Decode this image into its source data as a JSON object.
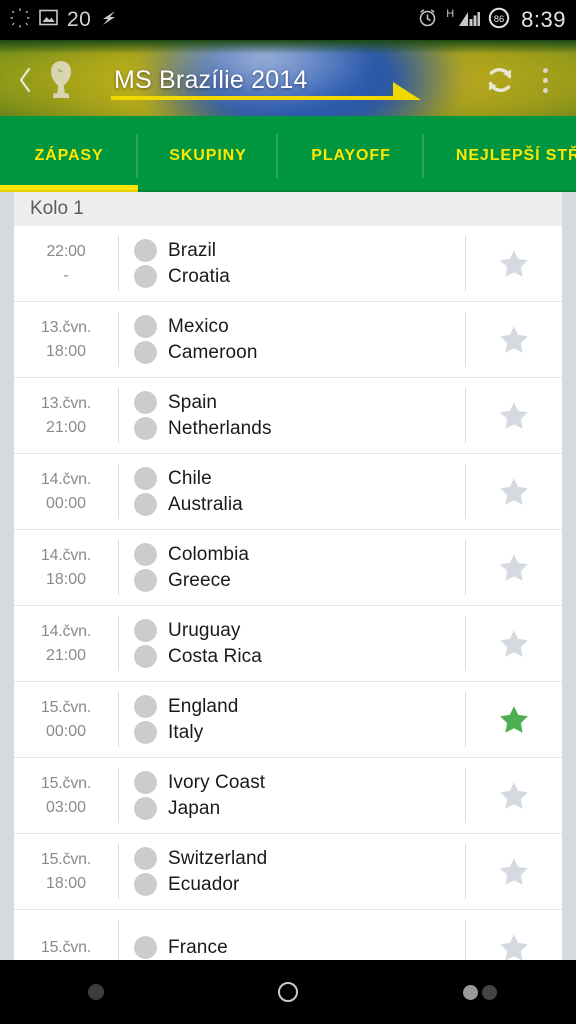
{
  "statusbar": {
    "brightness_icon": "brightness-icon",
    "screenshot_icon": "image-icon",
    "notif_count": "20",
    "charging_icon": "lightning-bolt-icon",
    "alarm_icon": "alarm-clock-icon",
    "network_type": "H",
    "signal_icon": "signal-bars-icon",
    "battery_level": "86",
    "clock": "8:39"
  },
  "header": {
    "back_icon": "back-chevron-icon",
    "logo_icon": "trophy-icon",
    "title": "MS Brazílie 2014",
    "refresh_icon": "refresh-icon",
    "overflow_icon": "overflow-menu-icon"
  },
  "tabs": {
    "active_index": 0,
    "items": [
      {
        "label": "ZÁPASY"
      },
      {
        "label": "SKUPINY"
      },
      {
        "label": "PLAYOFF"
      },
      {
        "label": "NEJLEPŠÍ STŘE"
      }
    ]
  },
  "list": {
    "group_header": "Kolo 1",
    "matches": [
      {
        "date": "",
        "time": "22:00",
        "home": "Brazil",
        "away": "Croatia",
        "favorite": false,
        "home_flag": "flag-brazil",
        "away_flag": "flag-croatia"
      },
      {
        "date": "13.čvn.",
        "time": "18:00",
        "home": "Mexico",
        "away": "Cameroon",
        "favorite": false,
        "home_flag": "flag-mexico",
        "away_flag": "flag-cameroon"
      },
      {
        "date": "13.čvn.",
        "time": "21:00",
        "home": "Spain",
        "away": "Netherlands",
        "favorite": false,
        "home_flag": "flag-spain",
        "away_flag": "flag-netherlands"
      },
      {
        "date": "14.čvn.",
        "time": "00:00",
        "home": "Chile",
        "away": "Australia",
        "favorite": false,
        "home_flag": "flag-chile",
        "away_flag": "flag-australia"
      },
      {
        "date": "14.čvn.",
        "time": "18:00",
        "home": "Colombia",
        "away": "Greece",
        "favorite": false,
        "home_flag": "flag-colombia",
        "away_flag": "flag-greece"
      },
      {
        "date": "14.čvn.",
        "time": "21:00",
        "home": "Uruguay",
        "away": "Costa Rica",
        "favorite": false,
        "home_flag": "flag-uruguay",
        "away_flag": "flag-costarica"
      },
      {
        "date": "15.čvn.",
        "time": "00:00",
        "home": "England",
        "away": "Italy",
        "favorite": true,
        "home_flag": "flag-england",
        "away_flag": "flag-italy"
      },
      {
        "date": "15.čvn.",
        "time": "03:00",
        "home": "Ivory Coast",
        "away": "Japan",
        "favorite": false,
        "home_flag": "flag-ivorycoast",
        "away_flag": "flag-japan"
      },
      {
        "date": "15.čvn.",
        "time": "18:00",
        "home": "Switzerland",
        "away": "Ecuador",
        "favorite": false,
        "home_flag": "flag-switzerland",
        "away_flag": "flag-ecuador"
      },
      {
        "date": "15.čvn.",
        "time": "",
        "home": "France",
        "away": "",
        "favorite": false,
        "home_flag": "flag-france",
        "away_flag": ""
      }
    ],
    "first_row_time_placeholder": "-"
  },
  "navbar": {
    "back_icon": "nav-back-icon",
    "home_icon": "nav-home-icon",
    "recents_icon": "nav-recents-icon"
  },
  "colors": {
    "brand_green": "#00953f",
    "accent_yellow": "#ffe600",
    "favorite_green": "#4caf50",
    "star_inactive": "#d5dae0",
    "page_bg": "#d6dae0"
  }
}
